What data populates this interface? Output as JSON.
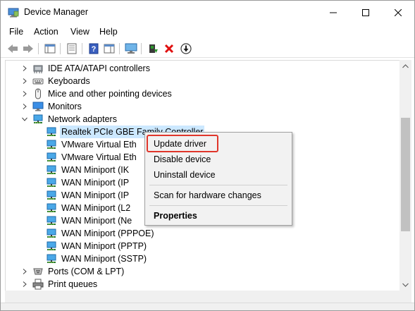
{
  "window": {
    "title": "Device Manager"
  },
  "menu": [
    "File",
    "Action",
    "View",
    "Help"
  ],
  "tree": [
    {
      "label": "IDE ATA/ATAPI controllers",
      "expanded": false,
      "level": 0,
      "icon": "ide-controller-icon"
    },
    {
      "label": "Keyboards",
      "expanded": false,
      "level": 0,
      "icon": "keyboard-icon"
    },
    {
      "label": "Mice and other pointing devices",
      "expanded": false,
      "level": 0,
      "icon": "mouse-icon"
    },
    {
      "label": "Monitors",
      "expanded": false,
      "level": 0,
      "icon": "monitor-icon"
    },
    {
      "label": "Network adapters",
      "expanded": true,
      "level": 0,
      "icon": "network-adapter-icon"
    },
    {
      "label": "Realtek PCIe GBE Family Controller",
      "level": 1,
      "icon": "network-adapter-icon",
      "selected": true
    },
    {
      "label": "VMware Virtual Eth",
      "level": 1,
      "icon": "network-adapter-icon"
    },
    {
      "label": "VMware Virtual Eth",
      "level": 1,
      "icon": "network-adapter-icon"
    },
    {
      "label": "WAN Miniport (IK",
      "level": 1,
      "icon": "network-adapter-icon"
    },
    {
      "label": "WAN Miniport (IP",
      "level": 1,
      "icon": "network-adapter-icon"
    },
    {
      "label": "WAN Miniport (IP",
      "level": 1,
      "icon": "network-adapter-icon"
    },
    {
      "label": "WAN Miniport (L2",
      "level": 1,
      "icon": "network-adapter-icon"
    },
    {
      "label": "WAN Miniport (Ne",
      "level": 1,
      "icon": "network-adapter-icon"
    },
    {
      "label": "WAN Miniport (PPPOE)",
      "level": 1,
      "icon": "network-adapter-icon"
    },
    {
      "label": "WAN Miniport (PPTP)",
      "level": 1,
      "icon": "network-adapter-icon"
    },
    {
      "label": "WAN Miniport (SSTP)",
      "level": 1,
      "icon": "network-adapter-icon"
    },
    {
      "label": "Ports (COM & LPT)",
      "expanded": false,
      "level": 0,
      "icon": "port-icon"
    },
    {
      "label": "Print queues",
      "expanded": false,
      "level": 0,
      "icon": "printer-icon"
    }
  ],
  "context_menu": {
    "items": [
      {
        "label": "Update driver",
        "highlighted": true
      },
      {
        "label": "Disable device"
      },
      {
        "label": "Uninstall device"
      },
      {
        "label": "Scan for hardware changes"
      },
      {
        "label": "Properties",
        "bold": true
      }
    ],
    "highlight_color": "#e0362b"
  },
  "colors": {
    "selection": "#cce8ff",
    "uninstall_red": "#e01010",
    "update_green": "#2e9a2e"
  }
}
